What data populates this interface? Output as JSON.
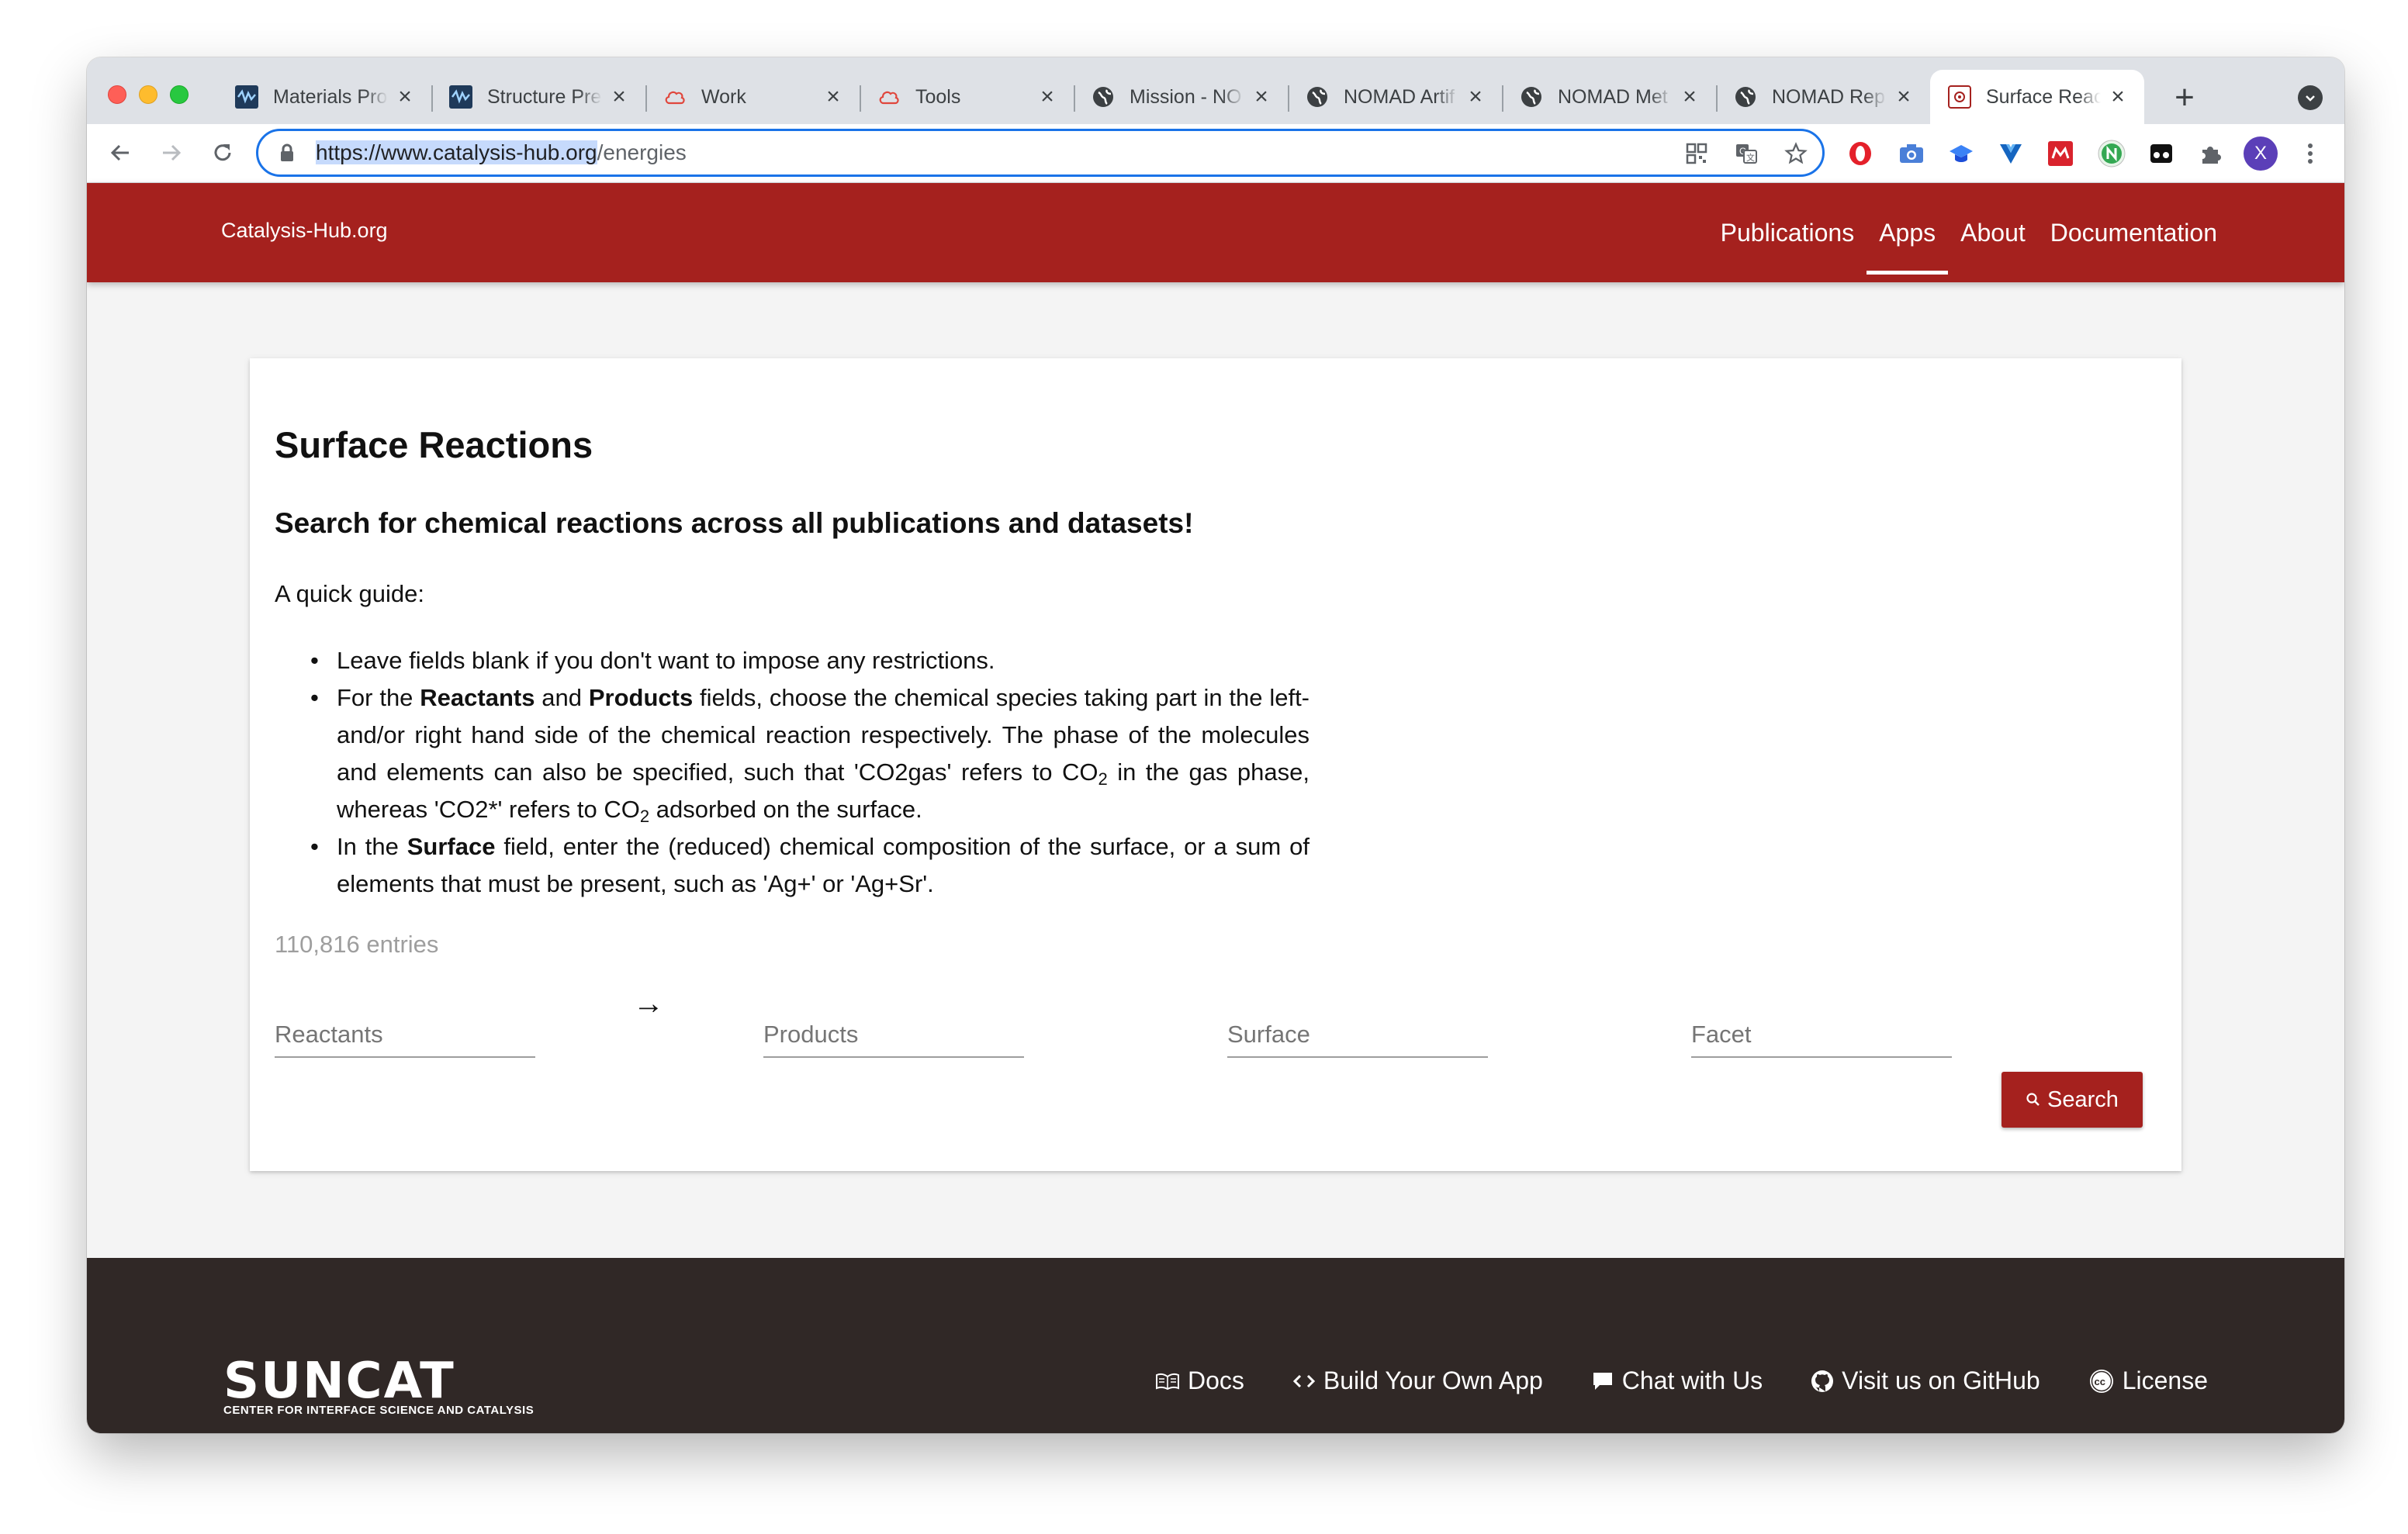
{
  "browser": {
    "tabs": [
      {
        "title": "Materials Pro",
        "favicon": "materials-project-icon"
      },
      {
        "title": "Structure Pre",
        "favicon": "materials-project-icon"
      },
      {
        "title": "Work",
        "favicon": "cloud-icon"
      },
      {
        "title": "Tools",
        "favicon": "cloud-icon"
      },
      {
        "title": "Mission - NO",
        "favicon": "globe-icon"
      },
      {
        "title": "NOMAD Artif",
        "favicon": "globe-icon"
      },
      {
        "title": "NOMAD Met",
        "favicon": "globe-icon"
      },
      {
        "title": "NOMAD Rep",
        "favicon": "globe-icon"
      },
      {
        "title": "Surface Reac",
        "favicon": "catalysis-hub-icon",
        "active": true
      }
    ],
    "url_selected": "https://www.catalysis-hub.org",
    "url_path": "/energies",
    "avatar_letter": "X"
  },
  "site": {
    "brand": "Catalysis-Hub.org",
    "nav": [
      {
        "label": "Publications"
      },
      {
        "label": "Apps",
        "active": true
      },
      {
        "label": "About"
      },
      {
        "label": "Documentation"
      }
    ]
  },
  "main": {
    "title": "Surface Reactions",
    "subtitle": "Search for chemical reactions across all publications and datasets!",
    "guide_title": "A quick guide:",
    "guide": {
      "item1": "Leave fields blank if you don't want to impose any restrictions.",
      "item2_a": "For the ",
      "item2_b": "Reactants",
      "item2_c": " and ",
      "item2_d": "Products",
      "item2_e": " fields, choose the chemical species taking part in the left- and/or right hand side of the chemical reaction respectively. The phase of the molecules and elements can also be specified, such that 'CO2gas' refers to CO",
      "item2_f": "2",
      "item2_g": " in the gas phase, whereas 'CO2*' refers to CO",
      "item2_h": "2",
      "item2_i": " adsorbed on the surface.",
      "item3_a": "In the ",
      "item3_b": "Surface",
      "item3_c": " field, enter the (reduced) chemical composition of the surface, or a sum of elements that must be present, such as 'Ag+' or 'Ag+Sr'."
    },
    "entries": "110,816 entries",
    "arrow": "→",
    "fields": {
      "reactants_placeholder": "Reactants",
      "products_placeholder": "Products",
      "surface_placeholder": "Surface",
      "facet_placeholder": "Facet"
    },
    "search_label": "Search"
  },
  "footer": {
    "logo_word": "SUNCAT",
    "logo_sub": "CENTER FOR INTERFACE SCIENCE AND CATALYSIS",
    "links": {
      "docs": "Docs",
      "build": "Build Your Own App",
      "chat": "Chat with Us",
      "github": "Visit us on GitHub",
      "license": "License"
    }
  },
  "colors": {
    "brand_red": "#a5211e",
    "footer_bg": "#302826",
    "focus_blue": "#1a73e8"
  }
}
